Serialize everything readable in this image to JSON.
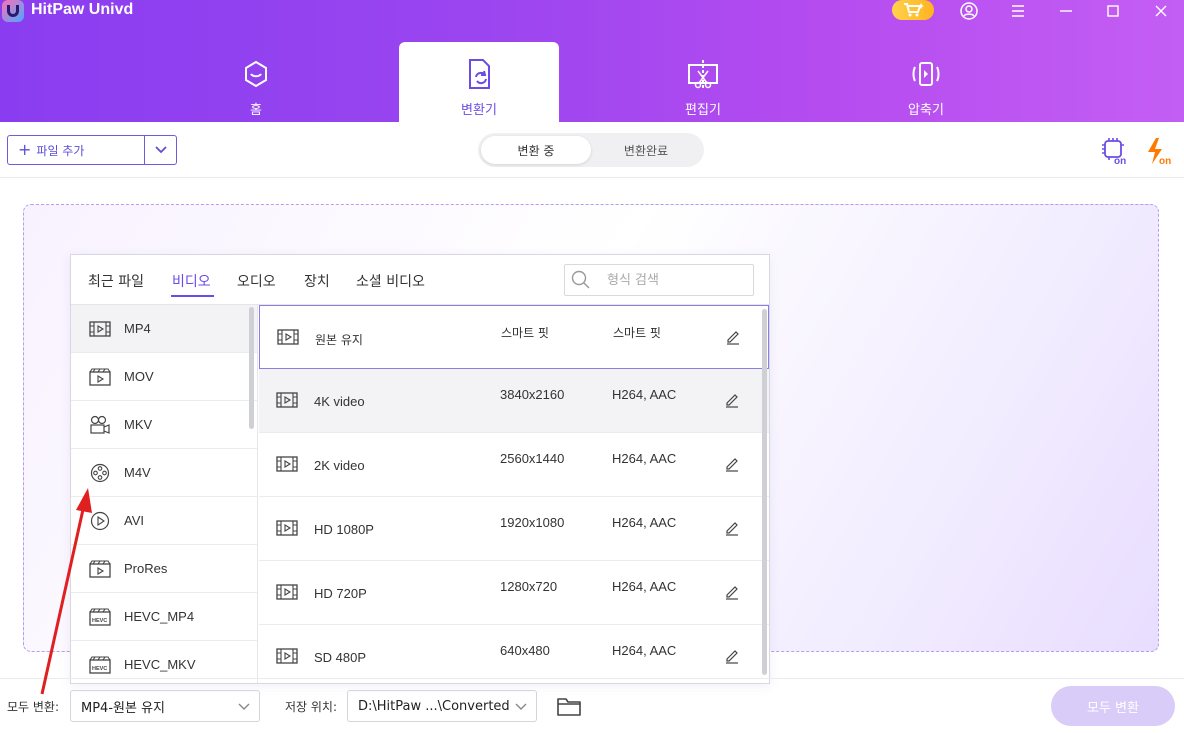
{
  "app": {
    "title": "HitPaw Univd"
  },
  "nav": {
    "tabs": [
      {
        "label": "홈",
        "icon": "home-icon"
      },
      {
        "label": "변환기",
        "icon": "converter-icon",
        "active": true
      },
      {
        "label": "편집기",
        "icon": "editor-icon"
      },
      {
        "label": "압축기",
        "icon": "compressor-icon"
      }
    ]
  },
  "toolbar": {
    "add_file_label": "파일 추가",
    "segments": [
      "변환 중",
      "변환완료"
    ]
  },
  "popup": {
    "tabs": [
      "최근 파일",
      "비디오",
      "오디오",
      "장치",
      "소셜 비디오"
    ],
    "active_tab": "비디오",
    "search_placeholder": "형식 검색",
    "formats": [
      "MP4",
      "MOV",
      "MKV",
      "M4V",
      "AVI",
      "ProRes",
      "HEVC_MP4",
      "HEVC_MKV"
    ],
    "selected_format": "MP4",
    "presets": [
      {
        "name": "원본 유지",
        "resolution": "스마트 핏",
        "codec": "스마트 핏"
      },
      {
        "name": "4K video",
        "resolution": "3840x2160",
        "codec": "H264, AAC"
      },
      {
        "name": "2K video",
        "resolution": "2560x1440",
        "codec": "H264, AAC"
      },
      {
        "name": "HD 1080P",
        "resolution": "1920x1080",
        "codec": "H264, AAC"
      },
      {
        "name": "HD 720P",
        "resolution": "1280x720",
        "codec": "H264, AAC"
      },
      {
        "name": "SD 480P",
        "resolution": "640x480",
        "codec": "H264, AAC"
      }
    ]
  },
  "bottom": {
    "convert_all_label": "모두 변환:",
    "convert_all_value": "MP4-원본 유지",
    "save_location_label": "저장 위치:",
    "save_location_value": "D:\\HitPaw ...\\Converted",
    "convert_all_button": "모두 변환"
  },
  "colors": {
    "accent": "#6b4de6",
    "header_gradient_start": "#8a3df0",
    "header_gradient_end": "#c35ef4",
    "hw_accel_orange": "#ff7a00"
  }
}
